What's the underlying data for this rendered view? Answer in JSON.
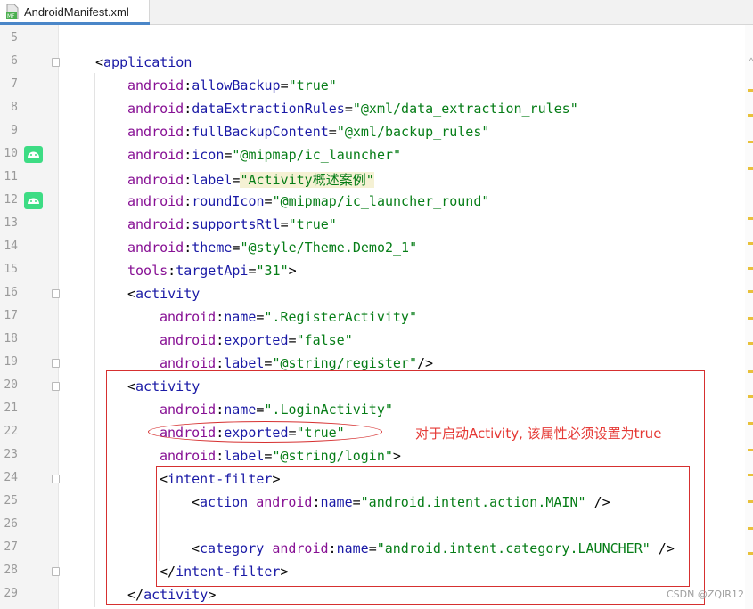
{
  "tab": {
    "icon_text": "MF",
    "label": "AndroidManifest.xml"
  },
  "lines": [
    {
      "n": "5"
    },
    {
      "n": "6",
      "parts": [
        [
          "p",
          "<"
        ],
        [
          "t",
          "application"
        ]
      ]
    },
    {
      "n": "7",
      "parts": [
        [
          "ns",
          "android"
        ],
        [
          "p",
          ":"
        ],
        [
          "a",
          "allowBackup"
        ],
        [
          "p",
          "="
        ],
        [
          "v",
          "\"true\""
        ]
      ]
    },
    {
      "n": "8",
      "parts": [
        [
          "ns",
          "android"
        ],
        [
          "p",
          ":"
        ],
        [
          "a",
          "dataExtractionRules"
        ],
        [
          "p",
          "="
        ],
        [
          "v",
          "\"@xml/data_extraction_rules\""
        ]
      ]
    },
    {
      "n": "9",
      "parts": [
        [
          "ns",
          "android"
        ],
        [
          "p",
          ":"
        ],
        [
          "a",
          "fullBackupContent"
        ],
        [
          "p",
          "="
        ],
        [
          "v",
          "\"@xml/backup_rules\""
        ]
      ]
    },
    {
      "n": "10",
      "parts": [
        [
          "ns",
          "android"
        ],
        [
          "p",
          ":"
        ],
        [
          "a",
          "icon"
        ],
        [
          "p",
          "="
        ],
        [
          "v",
          "\"@mipmap/ic_launcher\""
        ]
      ]
    },
    {
      "n": "11",
      "parts": [
        [
          "ns",
          "android"
        ],
        [
          "p",
          ":"
        ],
        [
          "a",
          "label"
        ],
        [
          "p",
          "="
        ],
        [
          "v",
          "\"Activity概述案例\""
        ]
      ]
    },
    {
      "n": "12",
      "parts": [
        [
          "ns",
          "android"
        ],
        [
          "p",
          ":"
        ],
        [
          "a",
          "roundIcon"
        ],
        [
          "p",
          "="
        ],
        [
          "v",
          "\"@mipmap/ic_launcher_round\""
        ]
      ]
    },
    {
      "n": "13",
      "parts": [
        [
          "ns",
          "android"
        ],
        [
          "p",
          ":"
        ],
        [
          "a",
          "supportsRtl"
        ],
        [
          "p",
          "="
        ],
        [
          "v",
          "\"true\""
        ]
      ]
    },
    {
      "n": "14",
      "parts": [
        [
          "ns",
          "android"
        ],
        [
          "p",
          ":"
        ],
        [
          "a",
          "theme"
        ],
        [
          "p",
          "="
        ],
        [
          "v",
          "\"@style/Theme.Demo2_1\""
        ]
      ]
    },
    {
      "n": "15",
      "parts": [
        [
          "ns",
          "tools"
        ],
        [
          "p",
          ":"
        ],
        [
          "a",
          "targetApi"
        ],
        [
          "p",
          "="
        ],
        [
          "v",
          "\"31\""
        ],
        [
          "p",
          ">"
        ]
      ]
    },
    {
      "n": "16",
      "parts": [
        [
          "p",
          "<"
        ],
        [
          "t",
          "activity"
        ]
      ]
    },
    {
      "n": "17",
      "parts": [
        [
          "ns",
          "android"
        ],
        [
          "p",
          ":"
        ],
        [
          "a",
          "name"
        ],
        [
          "p",
          "="
        ],
        [
          "v",
          "\".RegisterActivity\""
        ]
      ]
    },
    {
      "n": "18",
      "parts": [
        [
          "ns",
          "android"
        ],
        [
          "p",
          ":"
        ],
        [
          "a",
          "exported"
        ],
        [
          "p",
          "="
        ],
        [
          "v",
          "\"false\""
        ]
      ]
    },
    {
      "n": "19",
      "parts": [
        [
          "ns",
          "android"
        ],
        [
          "p",
          ":"
        ],
        [
          "a",
          "label"
        ],
        [
          "p",
          "="
        ],
        [
          "v",
          "\"@string/register\""
        ],
        [
          "p",
          "/>"
        ]
      ]
    },
    {
      "n": "20",
      "parts": [
        [
          "p",
          "<"
        ],
        [
          "t",
          "activity"
        ]
      ]
    },
    {
      "n": "21",
      "parts": [
        [
          "ns",
          "android"
        ],
        [
          "p",
          ":"
        ],
        [
          "a",
          "name"
        ],
        [
          "p",
          "="
        ],
        [
          "v",
          "\".LoginActivity\""
        ]
      ]
    },
    {
      "n": "22",
      "parts": [
        [
          "ns",
          "android"
        ],
        [
          "p",
          ":"
        ],
        [
          "a",
          "exported"
        ],
        [
          "p",
          "="
        ],
        [
          "v",
          "\"true\""
        ]
      ]
    },
    {
      "n": "23",
      "parts": [
        [
          "ns",
          "android"
        ],
        [
          "p",
          ":"
        ],
        [
          "a",
          "label"
        ],
        [
          "p",
          "="
        ],
        [
          "v",
          "\"@string/login\""
        ],
        [
          "p",
          ">"
        ]
      ]
    },
    {
      "n": "24",
      "parts": [
        [
          "p",
          "<"
        ],
        [
          "t",
          "intent-filter"
        ],
        [
          "p",
          ">"
        ]
      ]
    },
    {
      "n": "25",
      "parts": [
        [
          "p",
          "<"
        ],
        [
          "t",
          "action "
        ],
        [
          "ns",
          "android"
        ],
        [
          "p",
          ":"
        ],
        [
          "a",
          "name"
        ],
        [
          "p",
          "="
        ],
        [
          "v",
          "\"android.intent.action.MAIN\""
        ],
        [
          "p",
          " />"
        ]
      ]
    },
    {
      "n": "26"
    },
    {
      "n": "27",
      "parts": [
        [
          "p",
          "<"
        ],
        [
          "t",
          "category "
        ],
        [
          "ns",
          "android"
        ],
        [
          "p",
          ":"
        ],
        [
          "a",
          "name"
        ],
        [
          "p",
          "="
        ],
        [
          "v",
          "\"android.intent.category.LAUNCHER\""
        ],
        [
          "p",
          " />"
        ]
      ]
    },
    {
      "n": "28",
      "parts": [
        [
          "p",
          "</"
        ],
        [
          "t",
          "intent-filter"
        ],
        [
          "p",
          ">"
        ]
      ]
    },
    {
      "n": "29",
      "parts": [
        [
          "p",
          "</"
        ],
        [
          "t",
          "activity"
        ],
        [
          "p",
          ">"
        ]
      ]
    }
  ],
  "annotation": "对于启动Activity, 该属性必须设置为true",
  "watermark": "CSDN @ZQIR12",
  "colors": {
    "tag": "#1a1aa6",
    "namespace": "#871094",
    "attribute": "#1a1aa6",
    "value": "#067d17",
    "annotation": "#e53935",
    "highlight_box": "#d63030",
    "gutter_icon": "#3ddc84"
  },
  "gutter_icons": [
    "android-icon",
    "android-icon"
  ]
}
